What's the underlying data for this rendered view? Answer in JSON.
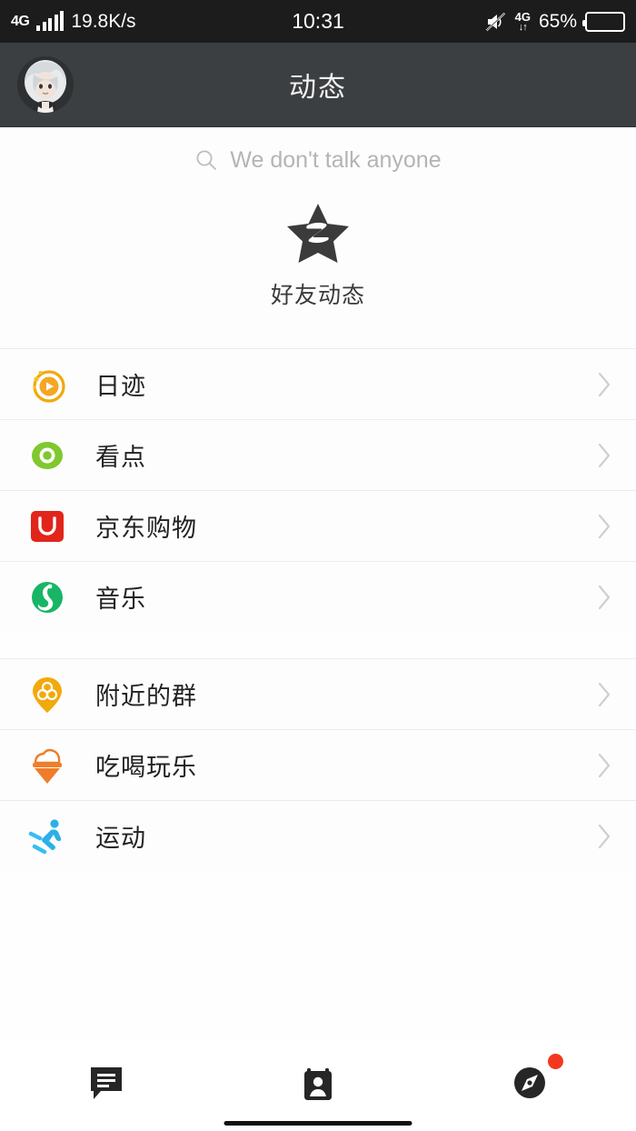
{
  "status_bar": {
    "network_type": "4G",
    "network_speed": "19.8K/s",
    "time": "10:31",
    "battery_percent": "65%",
    "data_indicator": "4G",
    "icons": {
      "signal": "signal-bars-icon",
      "mute": "mute-icon",
      "data-transfer": "data-transfer-arrows-icon",
      "battery": "battery-icon"
    }
  },
  "header": {
    "title": "动态",
    "avatar_name": "user-avatar"
  },
  "search": {
    "placeholder": "We don't talk anyone",
    "icon": "search-icon"
  },
  "featured": {
    "label": "好友动态",
    "icon": "star-qzone-icon"
  },
  "list_groups": [
    {
      "items": [
        {
          "label": "日迹",
          "icon": "daily-trace-play-icon",
          "color": "#f2a90c"
        },
        {
          "label": "看点",
          "icon": "kandian-eye-icon",
          "color": "#7fc82e"
        },
        {
          "label": "京东购物",
          "icon": "jd-shopping-icon",
          "color": "#e1251b"
        },
        {
          "label": "音乐",
          "icon": "music-note-icon",
          "color": "#1db954"
        }
      ]
    },
    {
      "items": [
        {
          "label": "附近的群",
          "icon": "nearby-group-pin-icon",
          "color": "#f2a90c"
        },
        {
          "label": "吃喝玩乐",
          "icon": "food-fun-cone-icon",
          "color": "#ef7d2a"
        },
        {
          "label": "运动",
          "icon": "sports-runner-icon",
          "color": "#2ab0e8"
        }
      ]
    }
  ],
  "bottom_nav": [
    {
      "name": "messages",
      "icon": "chat-bubble-icon",
      "active": false,
      "badge": false
    },
    {
      "name": "contacts",
      "icon": "contacts-card-icon",
      "active": false,
      "badge": false
    },
    {
      "name": "discover",
      "icon": "compass-icon",
      "active": true,
      "badge": true
    }
  ],
  "colors": {
    "status_bar_bg": "#1c1c1c",
    "header_bg": "#3c3f41",
    "page_bg": "#fdfdfd",
    "divider": "#ececec",
    "chevron": "#cfcfcf",
    "badge": "#f4381f"
  },
  "chevron_icon": "chevron-right-icon"
}
